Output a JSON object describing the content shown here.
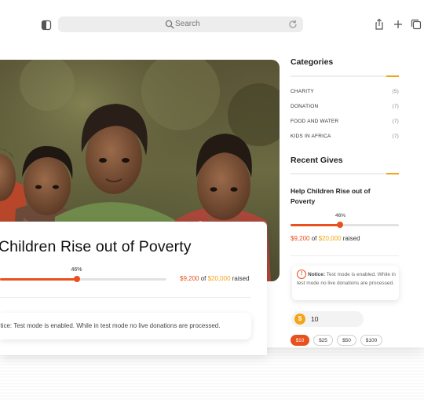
{
  "browser": {
    "search_placeholder": "Search"
  },
  "hero": {
    "image": "children-photo"
  },
  "campaign": {
    "title": "Children Rise out of Poverty",
    "progress_percent": 46,
    "progress_label": "46%",
    "raised_amount": "$9,200",
    "of_word": "of",
    "goal_amount": "$20,000",
    "raised_word": "raised",
    "notice": "otice: Test mode is enabled. While in test mode no live donations are processed."
  },
  "sidebar": {
    "categories_heading": "Categories",
    "categories": [
      {
        "label": "CHARITY",
        "count": "(5)"
      },
      {
        "label": "DONATION",
        "count": "(7)"
      },
      {
        "label": "FOOD AND WATER",
        "count": "(7)"
      },
      {
        "label": "KIDS IN AFRICA",
        "count": "(7)"
      }
    ],
    "recent_heading": "Recent Gives",
    "recent": {
      "title": "Help Children Rise out of Poverty",
      "progress_percent": 46,
      "progress_label": "46%",
      "raised_amount": "$9,200",
      "of_word": "of",
      "goal_amount": "$20,000",
      "raised_word": "raised"
    },
    "notice": {
      "icon": "!",
      "label": "Notice:",
      "text": " Test mode is enabled. While in test mode no live donations are processed."
    },
    "donation": {
      "currency_symbol": "$",
      "amount": "10",
      "presets": [
        "$10",
        "$25",
        "$50",
        "$100"
      ]
    }
  },
  "colors": {
    "accent": "#e8501e",
    "gold": "#f2a516"
  }
}
